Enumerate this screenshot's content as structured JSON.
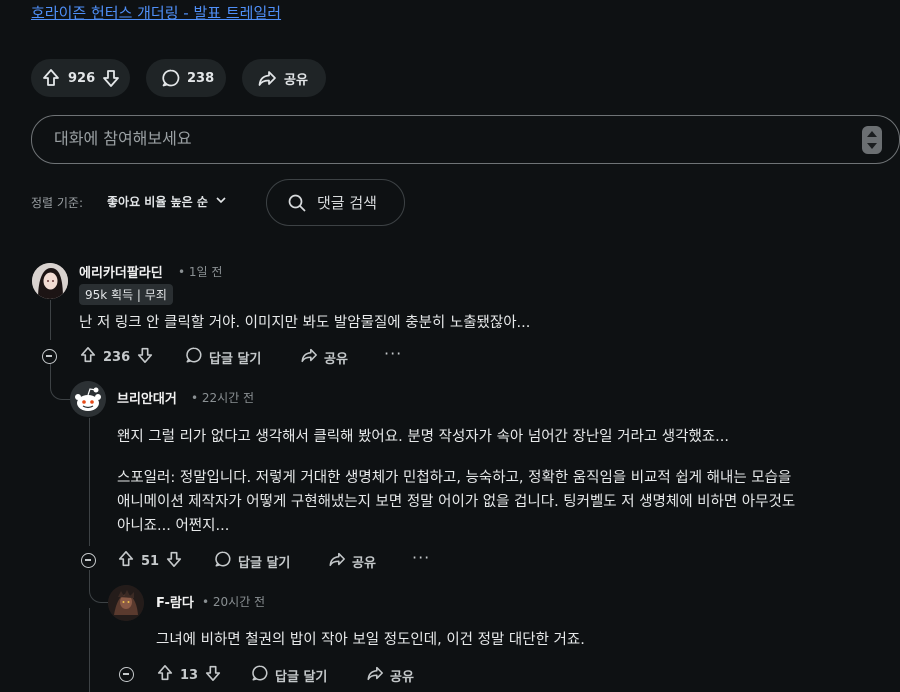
{
  "post": {
    "link_text": "호라이즌 헌터스 개더링 - 발표 트레일러",
    "upvotes": "926",
    "comments": "238",
    "share_label": "공유"
  },
  "composer": {
    "placeholder": "대화에 참여해보세요"
  },
  "sort": {
    "label": "정렬 기준:",
    "value": "좋아요 비율 높은 순",
    "search_label": "댓글 검색"
  },
  "comments": [
    {
      "author": "에리카더팔라딘",
      "time": "• 1일 전",
      "flair": "95k 획득 | 무죄",
      "body": "난 저 링크 안 클릭할 거야. 이미지만 봐도 발암물질에 충분히 노출됐잖아...",
      "score": "236",
      "reply_label": "답글 달기",
      "share_label": "공유",
      "more_label": "···"
    },
    {
      "author": "브리안대거",
      "time": "• 22시간 전",
      "body_p1": "왠지 그럴 리가 없다고 생각해서 클릭해 봤어요. 분명 작성자가 속아 넘어간 장난일 거라고 생각했죠...",
      "body_p2_l1": "스포일러: 정말입니다. 저렇게 거대한 생명체가 민첩하고, 능숙하고, 정확한 움직임을 비교적 쉽게 해내는 모습을",
      "body_p2_l2": "애니메이션 제작자가 어떻게 구현해냈는지 보면 정말 어이가 없을 겁니다. 팅커벨도 저 생명체에 비하면 아무것도",
      "body_p2_l3": "아니죠... 어쩐지...",
      "score": "51",
      "reply_label": "답글 달기",
      "share_label": "공유",
      "more_label": "···"
    },
    {
      "author": "F-람다",
      "time": "• 20시간 전",
      "body": "그녀에 비하면 철권의 밥이 작아 보일 정도인데, 이건 정말 대단한 거죠.",
      "score": "13",
      "reply_label": "답글 달기",
      "share_label": "공유"
    }
  ],
  "colors": {
    "background": "#0e1113",
    "link": "#4f8ff7",
    "pill": "#1f2426"
  }
}
